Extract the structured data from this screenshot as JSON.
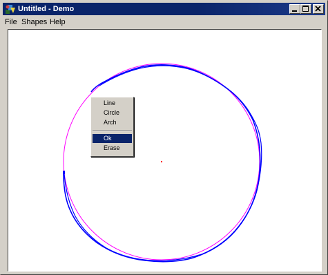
{
  "window": {
    "title": "Untitled - Demo",
    "buttons": [
      "minimize",
      "maximize",
      "close"
    ]
  },
  "menubar": {
    "items": [
      {
        "label": "File"
      },
      {
        "label": "Shapes"
      },
      {
        "label": "Help"
      }
    ]
  },
  "context_menu": {
    "items": [
      {
        "label": "Line",
        "selected": false
      },
      {
        "label": "Circle",
        "selected": false
      },
      {
        "label": "Arch",
        "selected": false
      },
      {
        "label": "Ok",
        "selected": true
      },
      {
        "label": "Erase",
        "selected": false
      }
    ]
  },
  "canvas": {
    "ideal_circle_color": "#ff00ff",
    "freehand_stroke_color": "#0000ff",
    "center_point_color": "#ff0000"
  },
  "colors": {
    "titlebar": "#0a246a",
    "window_face": "#d4d0c8",
    "selection": "#0a246a"
  }
}
